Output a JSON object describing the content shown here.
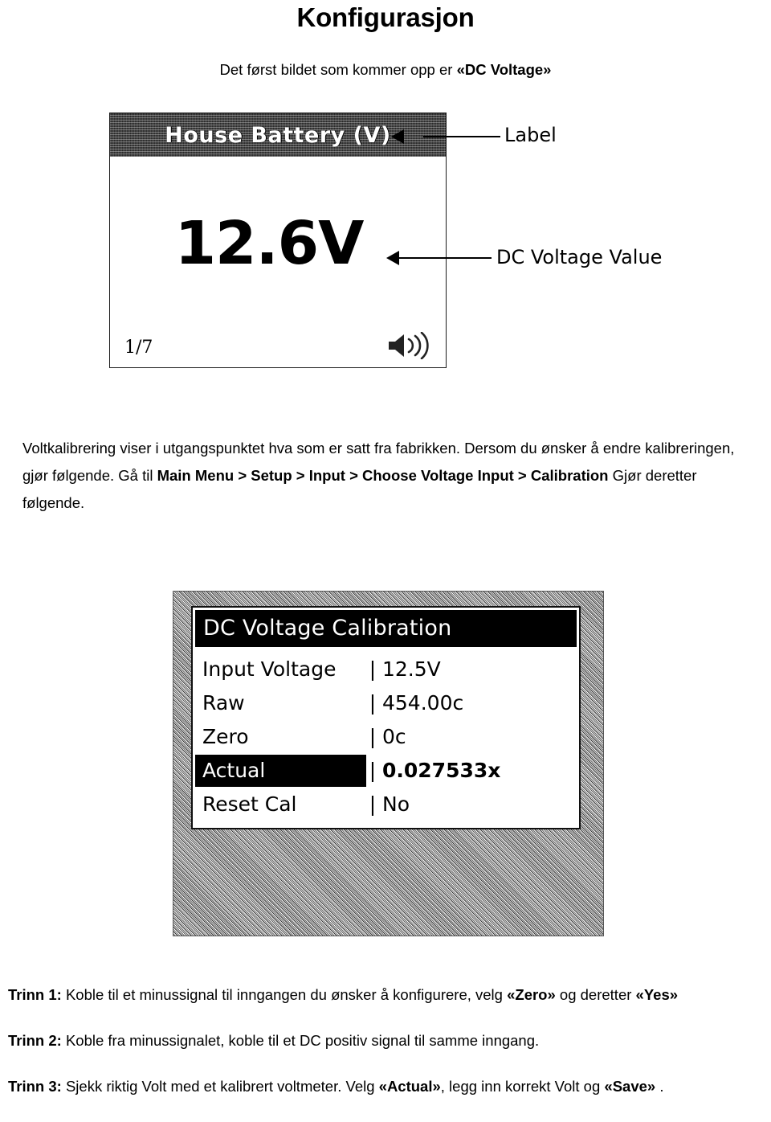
{
  "document": {
    "title": "Konfigurasjon",
    "subtitle_prefix": "Det først bildet som kommer opp er ",
    "subtitle_emphasis": "«DC Voltage»"
  },
  "figure_one": {
    "label_header": "House Battery (V)",
    "value": "12.6V",
    "page_indicator": "1/7",
    "speaker_icon": "speaker-sound-icon",
    "callouts": [
      {
        "id": "label",
        "text": "Label"
      },
      {
        "id": "value",
        "text": "DC Voltage Value"
      }
    ]
  },
  "paragraph": {
    "part1": "Voltkalibrering viser i utgangspunktet hva som er satt fra fabrikken. Dersom du ønsker å endre kalibreringen, gjør følgende. Gå til  ",
    "menu_path": "Main Menu > Setup > Input > Choose Voltage Input > Calibration",
    "part2": " Gjør deretter følgende."
  },
  "figure_two": {
    "title": "DC Voltage Calibration",
    "separator": "|",
    "rows": [
      {
        "key": "Input Voltage",
        "value": "12.5V",
        "selected": false
      },
      {
        "key": "Raw",
        "value": "454.00c",
        "selected": false
      },
      {
        "key": "Zero",
        "value": "0c",
        "selected": false
      },
      {
        "key": "Actual",
        "value": "0.027533x",
        "selected": true
      },
      {
        "key": "Reset Cal",
        "value": "No",
        "selected": false
      }
    ]
  },
  "steps": [
    {
      "label": "Trinn 1:",
      "text_a": " Koble til et minussignal til inngangen du ønsker å konfigurere, velg ",
      "emph_a": "«Zero»",
      "text_b": " og deretter ",
      "emph_b": "«Yes»",
      "text_c": ""
    },
    {
      "label": "Trinn 2:",
      "text_a": " Koble fra minussignalet, koble til et DC positiv signal til samme inngang.",
      "emph_a": "",
      "text_b": "",
      "emph_b": "",
      "text_c": ""
    },
    {
      "label": "Trinn 3:",
      "text_a": " Sjekk riktig Volt med et kalibrert voltmeter. Velg  ",
      "emph_a": "«Actual»",
      "text_b": ", legg inn korrekt Volt og ",
      "emph_b": "«Save»",
      "text_c": " ."
    }
  ],
  "colors": {
    "ink": "#000000",
    "paper": "#ffffff"
  }
}
